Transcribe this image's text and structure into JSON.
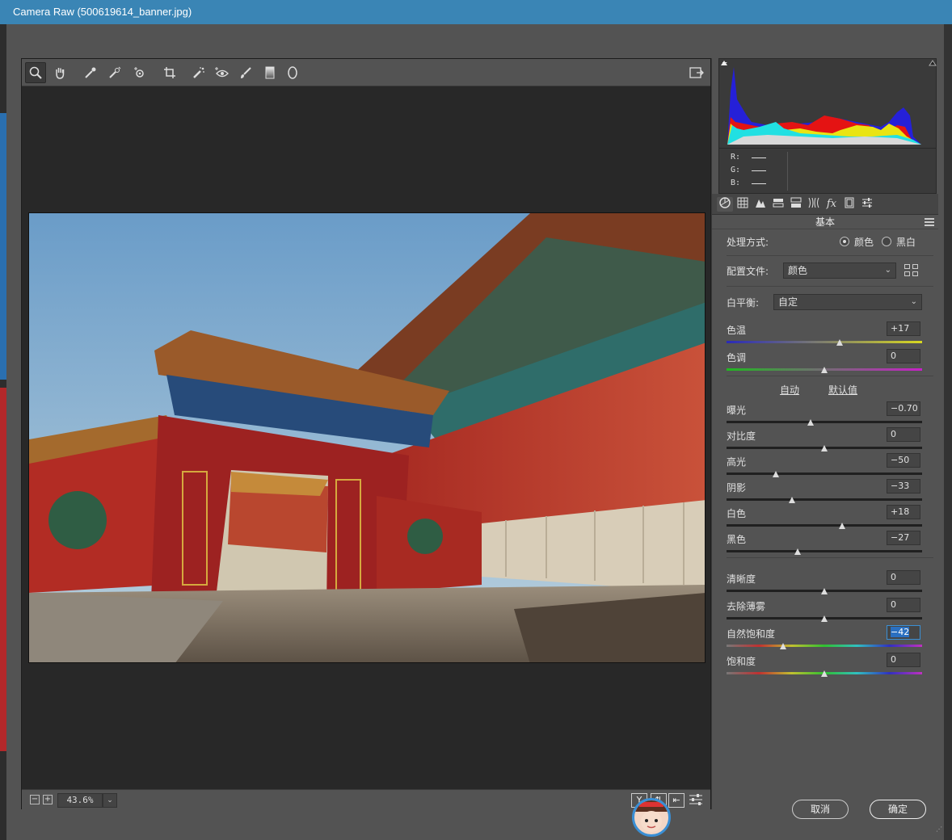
{
  "window": {
    "title": "Camera Raw (500619614_banner.jpg)"
  },
  "toolbar": {
    "tools": [
      "zoom-icon",
      "hand-icon",
      "white-balance-icon",
      "color-sampler-icon",
      "targeted-adjustment-icon",
      "crop-icon",
      "spot-removal-icon",
      "red-eye-icon",
      "adjustment-brush-icon",
      "graduated-filter-icon",
      "radial-filter-icon"
    ],
    "open_preferences_icon": "fullscreen-icon"
  },
  "histogram": {
    "r_label": "R:",
    "g_label": "G:",
    "b_label": "B:"
  },
  "panel": {
    "section_title": "基本",
    "treatment_label": "处理方式:",
    "treatment_color": "颜色",
    "treatment_bw": "黑白",
    "profile_label": "配置文件:",
    "profile_value": "颜色",
    "wb_label": "白平衡:",
    "wb_value": "自定",
    "auto_link": "自动",
    "default_link": "默认值",
    "sliders": [
      {
        "label": "色温",
        "value": "+17",
        "level": 0.58
      },
      {
        "label": "色调",
        "value": "0",
        "level": 0.5
      },
      {
        "label": "曝光",
        "value": "−0.70",
        "level": 0.43
      },
      {
        "label": "对比度",
        "value": "0",
        "level": 0.5
      },
      {
        "label": "高光",
        "value": "−50",
        "level": 0.25
      },
      {
        "label": "阴影",
        "value": "−33",
        "level": 0.335
      },
      {
        "label": "白色",
        "value": "+18",
        "level": 0.59
      },
      {
        "label": "黑色",
        "value": "−27",
        "level": 0.365
      },
      {
        "label": "清晰度",
        "value": "0",
        "level": 0.5
      },
      {
        "label": "去除薄雾",
        "value": "0",
        "level": 0.5
      },
      {
        "label": "自然饱和度",
        "value": "−42",
        "level": 0.29
      },
      {
        "label": "饱和度",
        "value": "0",
        "level": 0.5
      }
    ]
  },
  "bottom": {
    "zoom": "43.6%"
  },
  "footer": {
    "cancel": "取消",
    "ok": "确定"
  },
  "colors": {
    "titlebar": "#3a85b5",
    "panel": "#535353",
    "accent": "#3a8fd5"
  }
}
